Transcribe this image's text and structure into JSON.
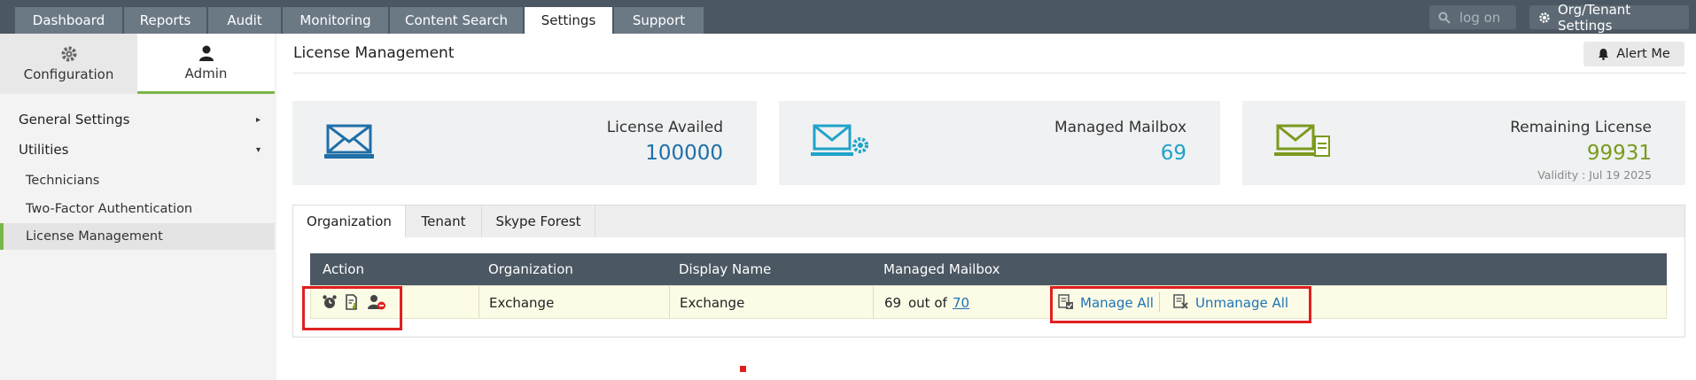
{
  "topnav": {
    "tabs": [
      {
        "label": "Dashboard"
      },
      {
        "label": "Reports"
      },
      {
        "label": "Audit"
      },
      {
        "label": "Monitoring"
      },
      {
        "label": "Content Search"
      },
      {
        "label": "Settings"
      },
      {
        "label": "Support"
      }
    ],
    "active_tab": "Settings",
    "search_placeholder": "log on",
    "org_button": "Org/Tenant Settings"
  },
  "sidebar": {
    "tabs": [
      {
        "label": "Configuration",
        "icon": "gear-icon"
      },
      {
        "label": "Admin",
        "icon": "user-icon"
      }
    ],
    "items": [
      {
        "label": "General Settings",
        "type": "section",
        "caret": "▸"
      },
      {
        "label": "Utilities",
        "type": "section",
        "caret": "▾"
      },
      {
        "label": "Technicians",
        "type": "sub"
      },
      {
        "label": "Two-Factor Authentication",
        "type": "sub"
      },
      {
        "label": "License Management",
        "type": "sub",
        "selected": true
      }
    ]
  },
  "main": {
    "title": "License Management",
    "alert_button": "Alert Me",
    "cards": [
      {
        "label": "License Availed",
        "value": "100000",
        "color": "#1f6fa8"
      },
      {
        "label": "Managed Mailbox",
        "value": "69",
        "color": "#1fa3c9"
      },
      {
        "label": "Remaining License",
        "value": "99931",
        "color": "#7a9a1c",
        "sub": "Validity : Jul 19 2025"
      }
    ],
    "panel_tabs": [
      "Organization",
      "Tenant",
      "Skype Forest"
    ],
    "table": {
      "headers": [
        "Action",
        "Organization",
        "Display Name",
        "Managed Mailbox"
      ],
      "rows": [
        {
          "organization": "Exchange",
          "display_name": "Exchange",
          "managed": "69",
          "out_of_text": "out of",
          "total": "70",
          "manage_all": "Manage All",
          "unmanage_all": "Unmanage All"
        }
      ]
    }
  }
}
